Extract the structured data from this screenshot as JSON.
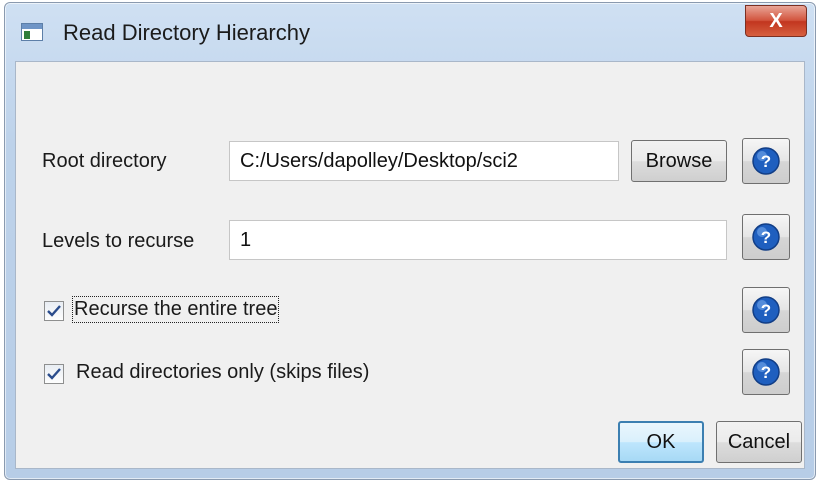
{
  "window": {
    "title": "Read Directory Hierarchy",
    "close_label": "X"
  },
  "form": {
    "root_directory": {
      "label": "Root directory",
      "value": "C:/Users/dapolley/Desktop/sci2",
      "browse_label": "Browse"
    },
    "levels": {
      "label": "Levels to recurse",
      "value": "1"
    },
    "recurse_tree": {
      "label": "Recurse the entire tree",
      "checked": true
    },
    "dirs_only": {
      "label": "Read directories only (skips files)",
      "checked": true
    }
  },
  "buttons": {
    "ok_label": "OK",
    "cancel_label": "Cancel"
  },
  "icons": {
    "help": "help-icon",
    "check": "checkmark-icon",
    "app": "app-window-icon"
  },
  "colors": {
    "help_icon_blue": "#1f5fbf",
    "ok_border": "#3c7fb1",
    "close_red": "#c2361f"
  }
}
